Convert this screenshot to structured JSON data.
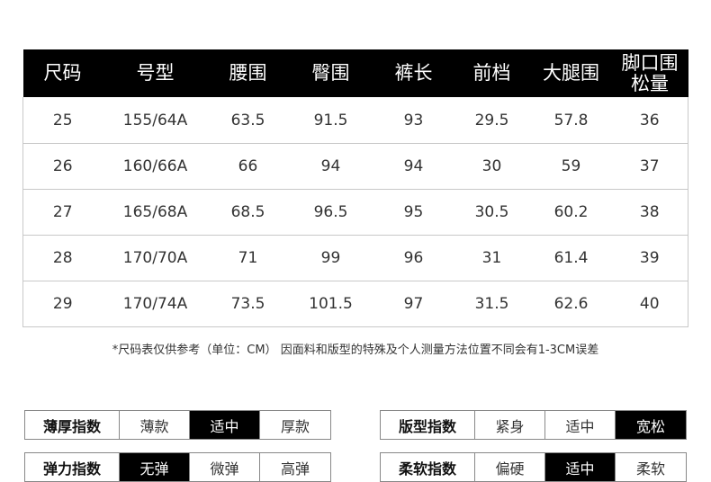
{
  "table": {
    "headers": [
      "尺码",
      "号型",
      "腰围",
      "臀围",
      "裤长",
      "前档",
      "大腿围",
      "脚口围\n松量"
    ],
    "rows": [
      [
        "25",
        "155/64A",
        "63.5",
        "91.5",
        "93",
        "29.5",
        "57.8",
        "36"
      ],
      [
        "26",
        "160/66A",
        "66",
        "94",
        "94",
        "30",
        "59",
        "37"
      ],
      [
        "27",
        "165/68A",
        "68.5",
        "96.5",
        "95",
        "30.5",
        "60.2",
        "38"
      ],
      [
        "28",
        "170/70A",
        "71",
        "99",
        "96",
        "31",
        "61.4",
        "39"
      ],
      [
        "29",
        "170/74A",
        "73.5",
        "101.5",
        "97",
        "31.5",
        "62.6",
        "40"
      ]
    ]
  },
  "note": "*尺码表仅供参考（单位：CM） 因面料和版型的特殊及个人测量方法位置不同会有1-3CM误差",
  "indices": [
    {
      "label": "薄厚指数",
      "options": [
        "薄款",
        "适中",
        "厚款"
      ],
      "selected": 1
    },
    {
      "label": "版型指数",
      "options": [
        "紧身",
        "适中",
        "宽松"
      ],
      "selected": 2
    },
    {
      "label": "弹力指数",
      "options": [
        "无弹",
        "微弹",
        "高弹"
      ],
      "selected": 0
    },
    {
      "label": "柔软指数",
      "options": [
        "偏硬",
        "适中",
        "柔软"
      ],
      "selected": 1
    }
  ]
}
